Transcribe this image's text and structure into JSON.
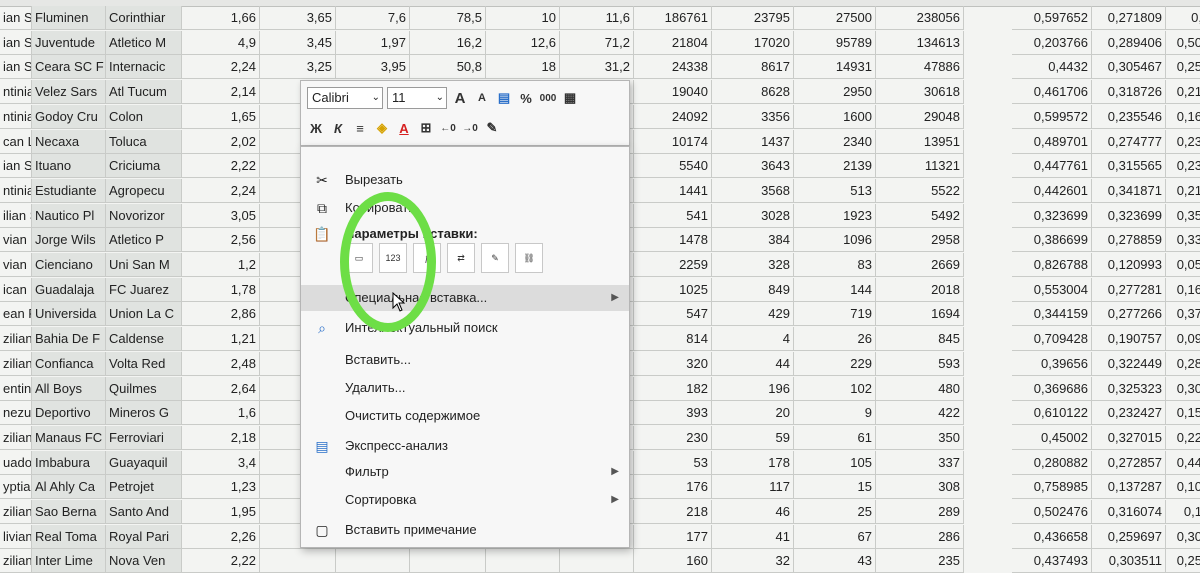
{
  "rows": [
    {
      "cells": [
        "ian S",
        "Fluminen",
        "Corinthiar",
        "1,66",
        "3,65",
        "7,6",
        "78,5",
        "10",
        "11,6",
        "186761",
        "23795",
        "27500",
        "238056",
        "0,597652",
        "0,271809",
        "0,"
      ]
    },
    {
      "cells": [
        "ian S",
        "Juventude",
        "Atletico M",
        "4,9",
        "3,45",
        "1,97",
        "16,2",
        "12,6",
        "71,2",
        "21804",
        "17020",
        "95789",
        "134613",
        "0,203766",
        "0,289406",
        "0,50"
      ]
    },
    {
      "cells": [
        "ian S",
        "Ceara SC F",
        "Internacic",
        "2,24",
        "3,25",
        "3,95",
        "50,8",
        "18",
        "31,2",
        "24338",
        "8617",
        "14931",
        "47886",
        "0,4432",
        "0,305467",
        "0,25"
      ]
    },
    {
      "cells": [
        "ntinia",
        "Velez Sars",
        "Atl Tucum",
        "2,14",
        "",
        "",
        "",
        "",
        "",
        "19040",
        "8628",
        "2950",
        "30618",
        "0,461706",
        "0,318726",
        "0,21"
      ]
    },
    {
      "cells": [
        "ntinia",
        "Godoy Cru",
        "Colon",
        "1,65",
        "",
        "",
        "",
        "",
        "",
        "24092",
        "3356",
        "1600",
        "29048",
        "0,599572",
        "0,235546",
        "0,16"
      ]
    },
    {
      "cells": [
        "can L",
        "Necaxa",
        "Toluca",
        "2,02",
        "",
        "",
        "",
        "",
        "",
        "10174",
        "1437",
        "2340",
        "13951",
        "0,489701",
        "0,274777",
        "0,23"
      ]
    },
    {
      "cells": [
        "ian S",
        "Ituano",
        "Criciuma",
        "2,22",
        "3,15",
        "4,3",
        "48,9",
        "33,2",
        "18,9",
        "5540",
        "3643",
        "2139",
        "11321",
        "0,447761",
        "0,315565",
        "0,23"
      ]
    },
    {
      "cells": [
        "ntinia",
        "Estudiante",
        "Agropecu",
        "2,24",
        "",
        "",
        "",
        "",
        "",
        "1441",
        "3568",
        "513",
        "5522",
        "0,442601",
        "0,341871",
        "0,21"
      ]
    },
    {
      "cells": [
        "ilian S",
        "Nautico Pl",
        "Novorizor",
        "3,05",
        "",
        "",
        "",
        "",
        "",
        "541",
        "3028",
        "1923",
        "5492",
        "0,323699",
        "0,323699",
        "0,35"
      ]
    },
    {
      "cells": [
        "vian L",
        "Jorge Wils",
        "Atletico P",
        "2,56",
        "",
        "",
        "",
        "",
        "",
        "1478",
        "384",
        "1096",
        "2958",
        "0,386699",
        "0,278859",
        "0,33"
      ]
    },
    {
      "cells": [
        "vian I",
        "Cienciano",
        "Uni San M",
        "1,2",
        "",
        "",
        "",
        "",
        "",
        "2259",
        "328",
        "83",
        "2669",
        "0,826788",
        "0,120993",
        "0,05"
      ]
    },
    {
      "cells": [
        "ican L",
        "Guadalaja",
        "FC Juarez",
        "1,78",
        "",
        "",
        "",
        "",
        "",
        "1025",
        "849",
        "144",
        "2018",
        "0,553004",
        "0,277281",
        "0,16"
      ]
    },
    {
      "cells": [
        "ean P",
        "Universida",
        "Union La C",
        "2,86",
        "",
        "",
        "",
        "",
        "",
        "547",
        "429",
        "719",
        "1694",
        "0,344159",
        "0,277266",
        "0,37"
      ]
    },
    {
      "cells": [
        "zilian S",
        "Bahia De F",
        "Caldense",
        "1,21",
        "",
        "",
        "",
        "",
        "",
        "814",
        "4",
        "26",
        "845",
        "0,709428",
        "0,190757",
        "0,09"
      ]
    },
    {
      "cells": [
        "zilian S",
        "Confianca",
        "Volta Red",
        "2,48",
        "",
        "",
        "",
        "",
        "",
        "320",
        "44",
        "229",
        "593",
        "0,39656",
        "0,322449",
        "0,28"
      ]
    },
    {
      "cells": [
        "entinia",
        "All Boys",
        "Quilmes",
        "2,64",
        "",
        "",
        "",
        "",
        "",
        "182",
        "196",
        "102",
        "480",
        "0,369686",
        "0,325323",
        "0,30"
      ]
    },
    {
      "cells": [
        "nezuel",
        "Deportivo",
        "Mineros G",
        "1,6",
        "",
        "",
        "",
        "",
        "",
        "393",
        "20",
        "9",
        "422",
        "0,610122",
        "0,232427",
        "0,15"
      ]
    },
    {
      "cells": [
        "zilian S",
        "Manaus FC",
        "Ferroviari",
        "2,18",
        "",
        "",
        "",
        "",
        "",
        "230",
        "59",
        "61",
        "350",
        "0,45002",
        "0,327015",
        "0,22"
      ]
    },
    {
      "cells": [
        "uadoria",
        "Imbabura",
        "Guayaquil",
        "3,4",
        "",
        "",
        "",
        "",
        "",
        "53",
        "178",
        "105",
        "337",
        "0,280882",
        "0,272857",
        "0,44"
      ]
    },
    {
      "cells": [
        "yptian C",
        "Al Ahly Ca",
        "Petrojet",
        "1,23",
        "",
        "",
        "",
        "",
        "",
        "176",
        "117",
        "15",
        "308",
        "0,758985",
        "0,137287",
        "0,10"
      ]
    },
    {
      "cells": [
        "zilian S",
        "Sao Berna",
        "Santo And",
        "1,95",
        "",
        "",
        "",
        "",
        "",
        "218",
        "46",
        "25",
        "289",
        "0,502476",
        "0,316074",
        "0,1"
      ]
    },
    {
      "cells": [
        "livian L",
        "Real Toma",
        "Royal Pari",
        "2,26",
        "",
        "",
        "",
        "",
        "",
        "177",
        "41",
        "67",
        "286",
        "0,436658",
        "0,259697",
        "0,30"
      ]
    },
    {
      "cells": [
        "zilian S",
        "Inter Lime",
        "Nova Ven",
        "2,22",
        "",
        "",
        "",
        "",
        "",
        "160",
        "32",
        "43",
        "235",
        "0,437493",
        "0,303511",
        "0,25"
      ]
    }
  ],
  "toolbar": {
    "font_name": "Calibri",
    "font_size": "11",
    "grow_font": "A",
    "shrink_font": "A",
    "percent": "%",
    "thousands": "000",
    "bold": "Ж",
    "italic": "К",
    "font_color_letter": "A"
  },
  "menu": {
    "cut": "Вырезать",
    "copy": "Копировать",
    "paste_options": "Параметры вставки:",
    "paste_values_badge": "123",
    "special_paste": "Специальная вставка...",
    "smart_lookup": "Интеллектуальный поиск",
    "insert": "Вставить...",
    "delete": "Удалить...",
    "clear": "Очистить содержимое",
    "quick_analysis": "Экспресс-анализ",
    "filter": "Фильтр",
    "sort": "Сортировка",
    "insert_comment": "Вставить примечание"
  },
  "colors": {
    "highlight_circle": "#6dde46"
  }
}
